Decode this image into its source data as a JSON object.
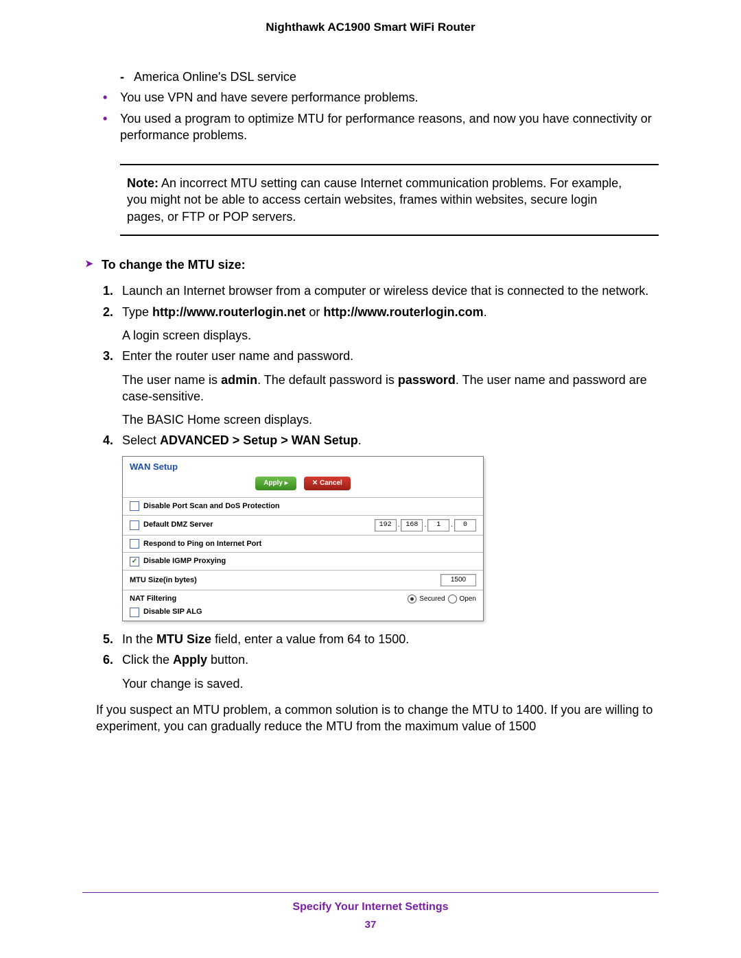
{
  "header": "Nighthawk AC1900 Smart WiFi Router",
  "intro": {
    "dash1": "America Online's DSL service",
    "b1": "You use VPN and have severe performance problems.",
    "b2": "You used a program to optimize MTU for performance reasons, and now you have connectivity or performance problems."
  },
  "note": {
    "label": "Note:",
    "body": " An incorrect MTU setting can cause Internet communication problems. For example, you might not be able to access certain websites, frames within websites, secure login pages, or FTP or POP servers."
  },
  "heading": "To change the MTU size:",
  "steps": {
    "s1": "Launch an Internet browser from a computer or wireless device that is connected to the network.",
    "s2_a": "Type ",
    "s2_b1": "http://www.routerlogin.net",
    "s2_mid": " or ",
    "s2_b2": "http://www.routerlogin.com",
    "s2_end": ".",
    "s2_p": "A login screen displays.",
    "s3": "Enter the router user name and password.",
    "s3_p1a": "The user name is ",
    "s3_admin": "admin",
    "s3_p1b": ". The default password is ",
    "s3_pw": "password",
    "s3_p1c": ". The user name and password are case-sensitive.",
    "s3_p2": "The BASIC Home screen displays.",
    "s4_a": "Select ",
    "s4_b": "ADVANCED > Setup > WAN Setup",
    "s4_c": ".",
    "s5_a": "In the ",
    "s5_b": "MTU Size",
    "s5_c": " field, enter a value from 64 to 1500.",
    "s6_a": "Click the ",
    "s6_b": "Apply",
    "s6_c": " button.",
    "s6_p": "Your change is saved."
  },
  "ss": {
    "title": "WAN Setup",
    "apply": "Apply ▸",
    "cancel": "✕ Cancel",
    "row1": "Disable Port Scan and DoS Protection",
    "row2": "Default DMZ Server",
    "ip1": "192",
    "ip2": "168",
    "ip3": "1",
    "ip4": "0",
    "row3": "Respond to Ping on Internet Port",
    "row4": "Disable IGMP Proxying",
    "row4_check": "✓",
    "row5": "MTU Size(in bytes)",
    "mtu": "1500",
    "nat": "NAT Filtering",
    "secured": "Secured",
    "open": "Open",
    "sip": "Disable SIP ALG"
  },
  "closing": "If you suspect an MTU problem, a common solution is to change the MTU to 1400. If you are willing to experiment, you can gradually reduce the MTU from the maximum value of 1500",
  "footer": {
    "section": "Specify Your Internet Settings",
    "page": "37"
  }
}
